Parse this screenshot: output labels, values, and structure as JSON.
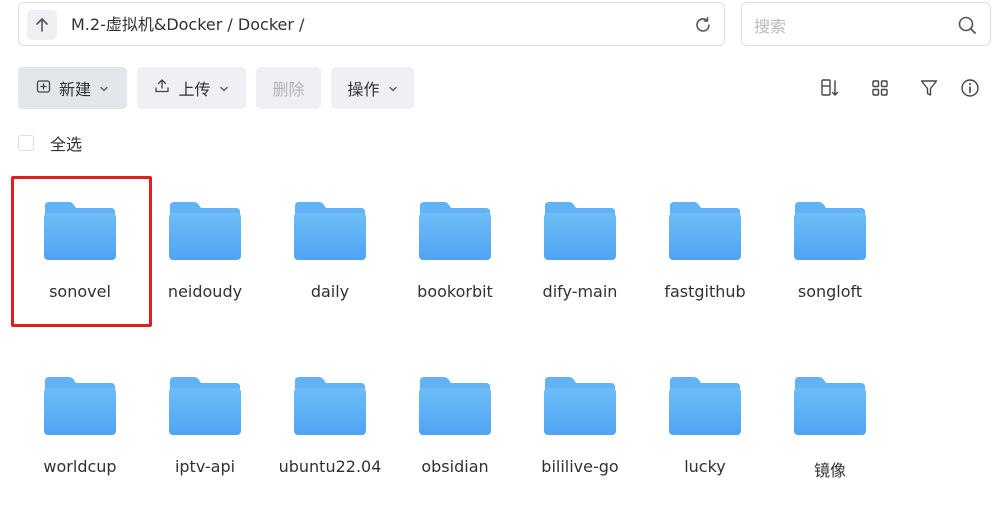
{
  "pathbar": {
    "up_icon": "arrow-up-icon",
    "path": "M.2-虚拟机&Docker / Docker /",
    "refresh_icon": "refresh-icon"
  },
  "search": {
    "placeholder": "搜索",
    "value": "",
    "icon": "search-icon"
  },
  "toolbar": {
    "new_label": "新建",
    "upload_label": "上传",
    "delete_label": "删除",
    "actions_label": "操作",
    "right_icons": [
      "sort-icon",
      "grid-view-icon",
      "filter-icon",
      "info-icon"
    ]
  },
  "select_all": {
    "label": "全选"
  },
  "folders": [
    {
      "name": "sonovel"
    },
    {
      "name": "neidoudy"
    },
    {
      "name": "daily"
    },
    {
      "name": "bookorbit"
    },
    {
      "name": "dify-main"
    },
    {
      "name": "fastgithub"
    },
    {
      "name": "songloft"
    },
    {
      "name": "worldcup"
    },
    {
      "name": "iptv-api"
    },
    {
      "name": "ubuntu22.04"
    },
    {
      "name": "obsidian"
    },
    {
      "name": "bililive-go"
    },
    {
      "name": "lucky"
    },
    {
      "name": "镜像"
    }
  ],
  "colors": {
    "folder_back": "#62b3f6",
    "folder_front": "#4fa4f3",
    "highlight": "#e02020"
  }
}
